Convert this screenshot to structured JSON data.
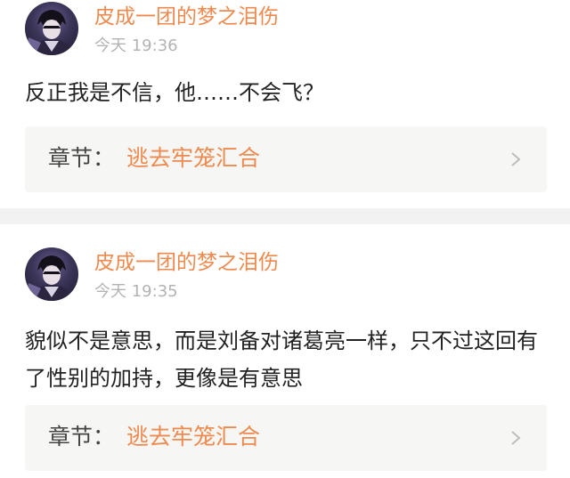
{
  "theme": {
    "accent": "#ef8a4f",
    "text": "#222222",
    "muted": "#b3b3b3",
    "chapter_bg": "#f6f6f4",
    "separator": "#f2f2f2"
  },
  "posts": [
    {
      "avatar_icon": "user-avatar-icon",
      "username": "皮成一团的梦之泪伤",
      "time": "今天 19:36",
      "comment": "反正我是不信，他……不会飞？",
      "chapter_prefix": "章节：",
      "chapter_title": "逃去牢笼汇合",
      "chevron_icon": "chevron-right-icon"
    },
    {
      "avatar_icon": "user-avatar-icon",
      "username": "皮成一团的梦之泪伤",
      "time": "今天 19:35",
      "comment": "貌似不是意思，而是刘备对诸葛亮一样，只不过这回有了性别的加持，更像是有意思",
      "chapter_prefix": "章节：",
      "chapter_title": "逃去牢笼汇合",
      "chevron_icon": "chevron-right-icon"
    }
  ]
}
